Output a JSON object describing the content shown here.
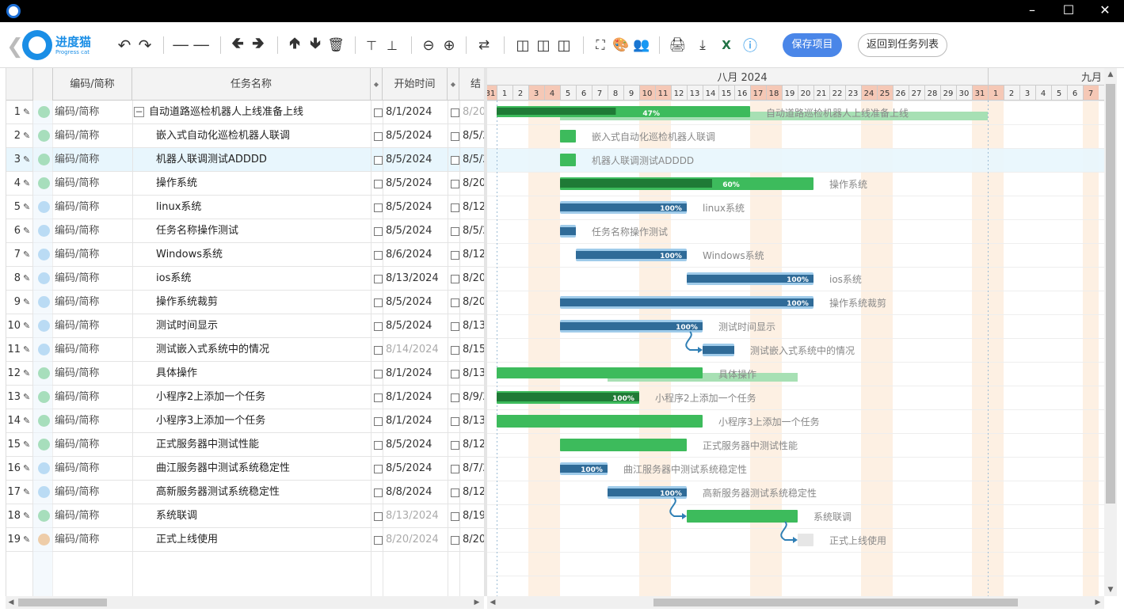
{
  "toolbar": {
    "logo_name": "进度猫",
    "logo_sub": "Progress cat",
    "save_label": "保存项目",
    "back_label": "返回到任务列表"
  },
  "grid": {
    "headers": {
      "code": "编码/简称",
      "name": "任务名称",
      "start": "开始时间",
      "end": "结"
    },
    "rows": [
      {
        "n": "1",
        "code": "编码/简称",
        "name": "自动道路巡检机器人上线准备上线",
        "start": "8/1/2024",
        "end": "8/20",
        "dot": "#3dbb5c",
        "level": 0,
        "collapse": true,
        "dimStart": false,
        "dimEnd": true
      },
      {
        "n": "2",
        "code": "编码/简称",
        "name": "嵌入式自动化巡检机器人联调",
        "start": "8/5/2024",
        "end": "8/5/2",
        "dot": "#3dbb5c",
        "level": 1
      },
      {
        "n": "3",
        "code": "编码/简称",
        "name": "机器人联调测试ADDDD",
        "start": "8/5/2024",
        "end": "8/5/2",
        "dot": "#3dbb5c",
        "level": 1,
        "selected": true
      },
      {
        "n": "4",
        "code": "编码/简称",
        "name": "操作系统",
        "start": "8/5/2024",
        "end": "8/20",
        "dot": "#3dbb5c",
        "level": 1
      },
      {
        "n": "5",
        "code": "编码/简称",
        "name": "linux系统",
        "start": "8/5/2024",
        "end": "8/12",
        "dot": "#6cb4e8",
        "level": 1
      },
      {
        "n": "6",
        "code": "编码/简称",
        "name": "任务名称操作测试",
        "start": "8/5/2024",
        "end": "8/5/2",
        "dot": "#6cb4e8",
        "level": 1
      },
      {
        "n": "7",
        "code": "编码/简称",
        "name": "Windows系统",
        "start": "8/6/2024",
        "end": "8/12",
        "dot": "#6cb4e8",
        "level": 1
      },
      {
        "n": "8",
        "code": "编码/简称",
        "name": "ios系统",
        "start": "8/13/2024",
        "end": "8/20",
        "dot": "#6cb4e8",
        "level": 1
      },
      {
        "n": "9",
        "code": "编码/简称",
        "name": "操作系统裁剪",
        "start": "8/5/2024",
        "end": "8/20",
        "dot": "#6cb4e8",
        "level": 1
      },
      {
        "n": "10",
        "code": "编码/简称",
        "name": "测试时间显示",
        "start": "8/5/2024",
        "end": "8/13",
        "dot": "#6cb4e8",
        "level": 1
      },
      {
        "n": "11",
        "code": "编码/简称",
        "name": "测试嵌入式系统中的情况",
        "start": "8/14/2024",
        "end": "8/15",
        "dot": "#6cb4e8",
        "level": 1,
        "dimStart": true
      },
      {
        "n": "12",
        "code": "编码/简称",
        "name": "具体操作",
        "start": "8/1/2024",
        "end": "8/13",
        "dot": "#3dbb5c",
        "level": 1
      },
      {
        "n": "13",
        "code": "编码/简称",
        "name": "小程序2上添加一个任务",
        "start": "8/1/2024",
        "end": "8/9/2",
        "dot": "#3dbb5c",
        "level": 1
      },
      {
        "n": "14",
        "code": "编码/简称",
        "name": "小程序3上添加一个任务",
        "start": "8/1/2024",
        "end": "8/13",
        "dot": "#3dbb5c",
        "level": 1
      },
      {
        "n": "15",
        "code": "编码/简称",
        "name": "正式服务器中测试性能",
        "start": "8/5/2024",
        "end": "8/12",
        "dot": "#3dbb5c",
        "level": 1
      },
      {
        "n": "16",
        "code": "编码/简称",
        "name": "曲江服务器中测试系统稳定性",
        "start": "8/5/2024",
        "end": "8/7/2",
        "dot": "#6cb4e8",
        "level": 1
      },
      {
        "n": "17",
        "code": "编码/简称",
        "name": "高新服务器测试系统稳定性",
        "start": "8/8/2024",
        "end": "8/12",
        "dot": "#6cb4e8",
        "level": 1
      },
      {
        "n": "18",
        "code": "编码/简称",
        "name": "系统联调",
        "start": "8/13/2024",
        "end": "8/19",
        "dot": "#3dbb5c",
        "level": 1,
        "dimStart": true
      },
      {
        "n": "19",
        "code": "编码/简称",
        "name": "正式上线使用",
        "start": "8/20/2024",
        "end": "8/20",
        "dot": "#f0902e",
        "level": 1,
        "dimStart": true
      }
    ]
  },
  "gantt": {
    "month1": "八月 2024",
    "month2": "九月",
    "days_prefix": [
      "31"
    ],
    "aug_days": [
      "1",
      "2",
      "3",
      "4",
      "5",
      "6",
      "7",
      "8",
      "9",
      "10",
      "11",
      "12",
      "13",
      "14",
      "15",
      "16",
      "17",
      "18",
      "19",
      "20",
      "21",
      "22",
      "23",
      "24",
      "25",
      "26",
      "27",
      "28",
      "29",
      "30",
      "31"
    ],
    "sep_days": [
      "1",
      "2",
      "3",
      "4",
      "5",
      "6",
      "7"
    ],
    "weekend_aug": [
      3,
      4,
      10,
      11,
      17,
      18,
      24,
      25,
      31
    ],
    "weekend_sep": [
      1,
      7
    ],
    "tasks": [
      {
        "row": 0,
        "start": 1,
        "end": 17,
        "progress": 0.47,
        "label": "47%",
        "name": "自动道路巡检机器人上线准备上线",
        "color": "green",
        "baseline": [
          5,
          32
        ]
      },
      {
        "row": 1,
        "start": 5,
        "end": 6,
        "progress": 0,
        "name": "嵌入式自动化巡检机器人联调",
        "color": "green"
      },
      {
        "row": 2,
        "start": 5,
        "end": 6,
        "progress": 0,
        "name": "机器人联调测试ADDDD",
        "color": "green"
      },
      {
        "row": 3,
        "start": 5,
        "end": 21,
        "progress": 0.6,
        "label": "60%",
        "name": "操作系统",
        "color": "green"
      },
      {
        "row": 4,
        "start": 5,
        "end": 13,
        "progress": 1,
        "label": "100%",
        "name": "linux系统",
        "color": "blue"
      },
      {
        "row": 5,
        "start": 5,
        "end": 6,
        "progress": 1,
        "name": "任务名称操作测试",
        "color": "blue"
      },
      {
        "row": 6,
        "start": 6,
        "end": 13,
        "progress": 1,
        "label": "100%",
        "name": "Windows系统",
        "color": "blue"
      },
      {
        "row": 7,
        "start": 13,
        "end": 21,
        "progress": 1,
        "label": "100%",
        "name": "ios系统",
        "color": "blue"
      },
      {
        "row": 8,
        "start": 5,
        "end": 21,
        "progress": 1,
        "label": "100%",
        "name": "操作系统裁剪",
        "color": "blue"
      },
      {
        "row": 9,
        "start": 5,
        "end": 14,
        "progress": 1,
        "label": "100%",
        "name": "测试时间显示",
        "color": "blue"
      },
      {
        "row": 10,
        "start": 14,
        "end": 16,
        "progress": 1,
        "name": "测试嵌入式系统中的情况",
        "color": "blue"
      },
      {
        "row": 11,
        "start": 1,
        "end": 14,
        "progress": 0,
        "name": "具体操作",
        "color": "green",
        "baseline": [
          8,
          20
        ]
      },
      {
        "row": 12,
        "start": 1,
        "end": 10,
        "progress": 1,
        "label": "100%",
        "name": "小程序2上添加一个任务",
        "color": "green"
      },
      {
        "row": 13,
        "start": 1,
        "end": 14,
        "progress": 0,
        "name": "小程序3上添加一个任务",
        "color": "green"
      },
      {
        "row": 14,
        "start": 5,
        "end": 13,
        "progress": 0,
        "name": "正式服务器中测试性能",
        "color": "green"
      },
      {
        "row": 15,
        "start": 5,
        "end": 8,
        "progress": 1,
        "label": "100%",
        "name": "曲江服务器中测试系统稳定性",
        "color": "blue"
      },
      {
        "row": 16,
        "start": 8,
        "end": 13,
        "progress": 1,
        "label": "100%",
        "name": "高新服务器测试系统稳定性",
        "color": "blue"
      },
      {
        "row": 17,
        "start": 13,
        "end": 20,
        "progress": 0,
        "name": "系统联调",
        "color": "green"
      },
      {
        "row": 18,
        "start": 20,
        "end": 21,
        "progress": 0,
        "name": "正式上线使用",
        "color": "gray"
      }
    ],
    "links": [
      [
        9,
        10
      ],
      [
        16,
        17
      ],
      [
        17,
        18
      ]
    ]
  }
}
